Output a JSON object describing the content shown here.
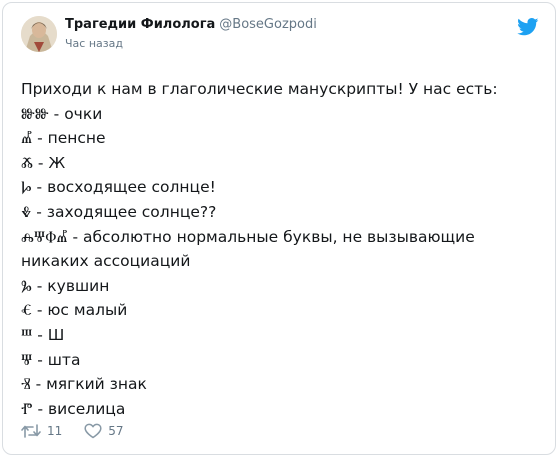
{
  "tweet": {
    "author_name": "Трагедии Филолога",
    "author_handle": "@BoseGozpodi",
    "timestamp": "Час назад",
    "lines": [
      "Приходи к нам в глаголические манускрипты! У нас есть:",
      "ⰖⰖ - очки",
      "Ⰼ - пенсне",
      "Ⰶ - Ж",
      "Ⱈ - восходящее солнце!",
      "Ⰷ - заходящее солнце??",
      "ⰎⰛⰗⰌ - абсолютно нормальные буквы, не вызывающие",
      "никаких ассоциаций",
      "Ⰳ - кувшин",
      "Ⱔ - юс малый",
      "Ⱎ - Ш",
      "Ⱋ - шта",
      "Ⱐ - мягкий знак",
      "Ⱂ - виселица"
    ],
    "retweets": "11",
    "likes": "57"
  },
  "icons": {
    "avatar": "avatar",
    "brand": "twitter-bird-icon",
    "retweet": "retweet-icon",
    "like": "heart-icon"
  },
  "colors": {
    "brand": "#1da1f2",
    "text": "#14171a",
    "muted": "#657786",
    "border": "#d9dde1"
  }
}
